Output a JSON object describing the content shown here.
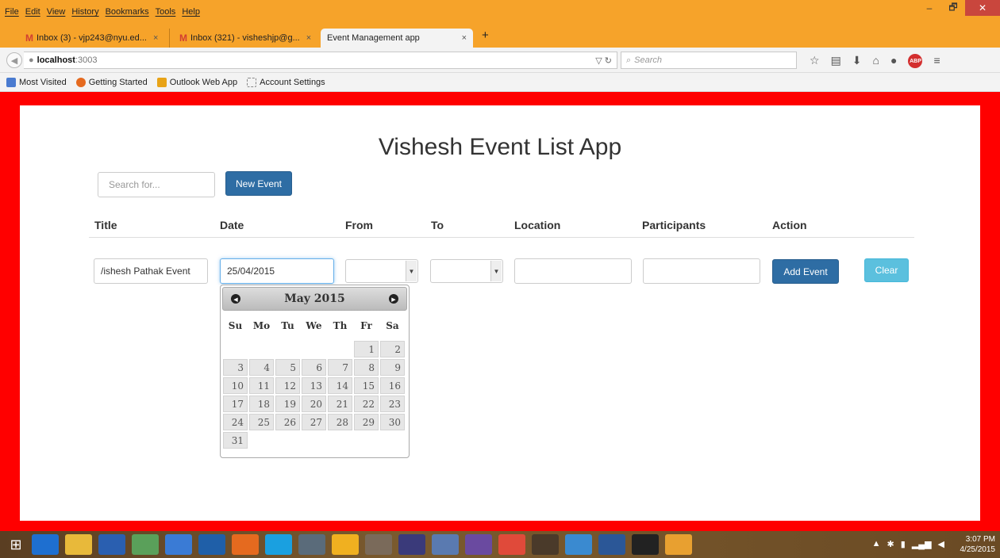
{
  "browser": {
    "menus": [
      "File",
      "Edit",
      "View",
      "History",
      "Bookmarks",
      "Tools",
      "Help"
    ],
    "window_controls": {
      "minimize": "–",
      "restore": "🗗",
      "close": "✕"
    },
    "tabs": [
      {
        "label": "Inbox (3) - vjp243@nyu.ed...",
        "close": "×"
      },
      {
        "label": "Inbox (321) - visheshjp@g...",
        "close": "×"
      },
      {
        "label": "Event Management app",
        "close": "×"
      }
    ],
    "new_tab": "+",
    "url_host": "localhost",
    "url_port": ":3003",
    "search_placeholder": "Search",
    "bookmarks": [
      "Most Visited",
      "Getting Started",
      "Outlook Web App",
      "Account Settings"
    ]
  },
  "app": {
    "title": "Vishesh Event List App",
    "search_placeholder": "Search for...",
    "new_event_label": "New Event",
    "columns": [
      "Title",
      "Date",
      "From",
      "To",
      "Location",
      "Participants",
      "Action"
    ],
    "form": {
      "title_value": "/ishesh Pathak Event",
      "date_value": "25/04/2015",
      "from_value": "",
      "to_value": "",
      "location_value": "",
      "participants_value": "",
      "add_label": "Add Event",
      "clear_label": "Clear"
    },
    "datepicker": {
      "month_label": "May 2015",
      "prev": "◀",
      "next": "▶",
      "weekdays": [
        "Su",
        "Mo",
        "Tu",
        "We",
        "Th",
        "Fr",
        "Sa"
      ],
      "leading_blanks": 5,
      "days": [
        "1",
        "2",
        "3",
        "4",
        "5",
        "6",
        "7",
        "8",
        "9",
        "10",
        "11",
        "12",
        "13",
        "14",
        "15",
        "16",
        "17",
        "18",
        "19",
        "20",
        "21",
        "22",
        "23",
        "24",
        "25",
        "26",
        "27",
        "28",
        "29",
        "30",
        "31"
      ]
    }
  },
  "taskbar": {
    "time": "3:07 PM",
    "date": "4/25/2015",
    "icons": [
      "ie-icon",
      "explorer-icon",
      "lenovo-icon",
      "photos-icon",
      "paint-icon",
      "outlook-icon",
      "firefox-icon",
      "skype-icon",
      "app-icon",
      "yahoo-icon",
      "files-icon",
      "eclipse-icon",
      "tool-icon",
      "github-icon",
      "chrome-icon",
      "javaee-icon",
      "remote-icon",
      "word-icon",
      "cmd-icon",
      "sublime-icon"
    ]
  }
}
